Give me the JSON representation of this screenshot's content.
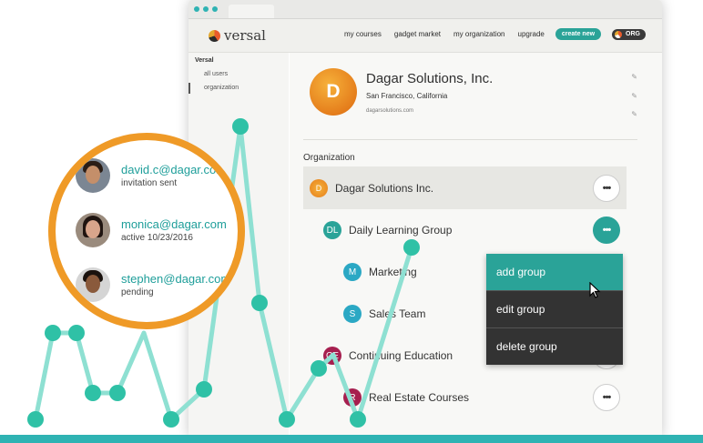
{
  "app": {
    "brand": "versal",
    "nav": [
      "my courses",
      "gadget market",
      "my organization",
      "upgrade"
    ],
    "create_button": "create new",
    "org_button": "ORG"
  },
  "sidebar": {
    "title": "Versal",
    "items": [
      {
        "label": "all users",
        "active": false
      },
      {
        "label": "organization",
        "active": true
      }
    ]
  },
  "company": {
    "initial": "D",
    "name": "Dagar Solutions, Inc.",
    "location": "San Francisco, California",
    "url": "dagarsolutions.com"
  },
  "organization": {
    "section_title": "Organization",
    "root": {
      "label": "Dagar Solutions Inc.",
      "initial": "D"
    },
    "groups": [
      {
        "initials": "DL",
        "label": "Daily Learning Group",
        "color": "#2aa398"
      },
      {
        "initials": "M",
        "label": "Marketing",
        "color": "#2ba8c4"
      },
      {
        "initials": "S",
        "label": "Sales Team",
        "color": "#2ba8c4"
      },
      {
        "initials": "CE",
        "label": "Continuing Education",
        "color": "#a61f4f"
      },
      {
        "initials": "R",
        "label": "Real Estate Courses",
        "color": "#a61f4f"
      }
    ],
    "more_label": "•••"
  },
  "context_menu": [
    "add group",
    "edit group",
    "delete group"
  ],
  "magnifier_users": [
    {
      "email": "david.c@dagar.com",
      "status": "invitation sent"
    },
    {
      "email": "monica@dagar.com",
      "status": "active 10/23/2016"
    },
    {
      "email": "stephen@dagar.com",
      "status": "pending"
    }
  ],
  "colors": {
    "accent": "#2aa398",
    "chart_line": "#8ee0d2",
    "chart_dot": "#2fc1a6",
    "magnifier_ring": "#ef9a27",
    "menu_bg": "#333333"
  },
  "icons": [
    "more-icon",
    "pencil-icon",
    "cursor-icon",
    "versal-logo-icon"
  ]
}
